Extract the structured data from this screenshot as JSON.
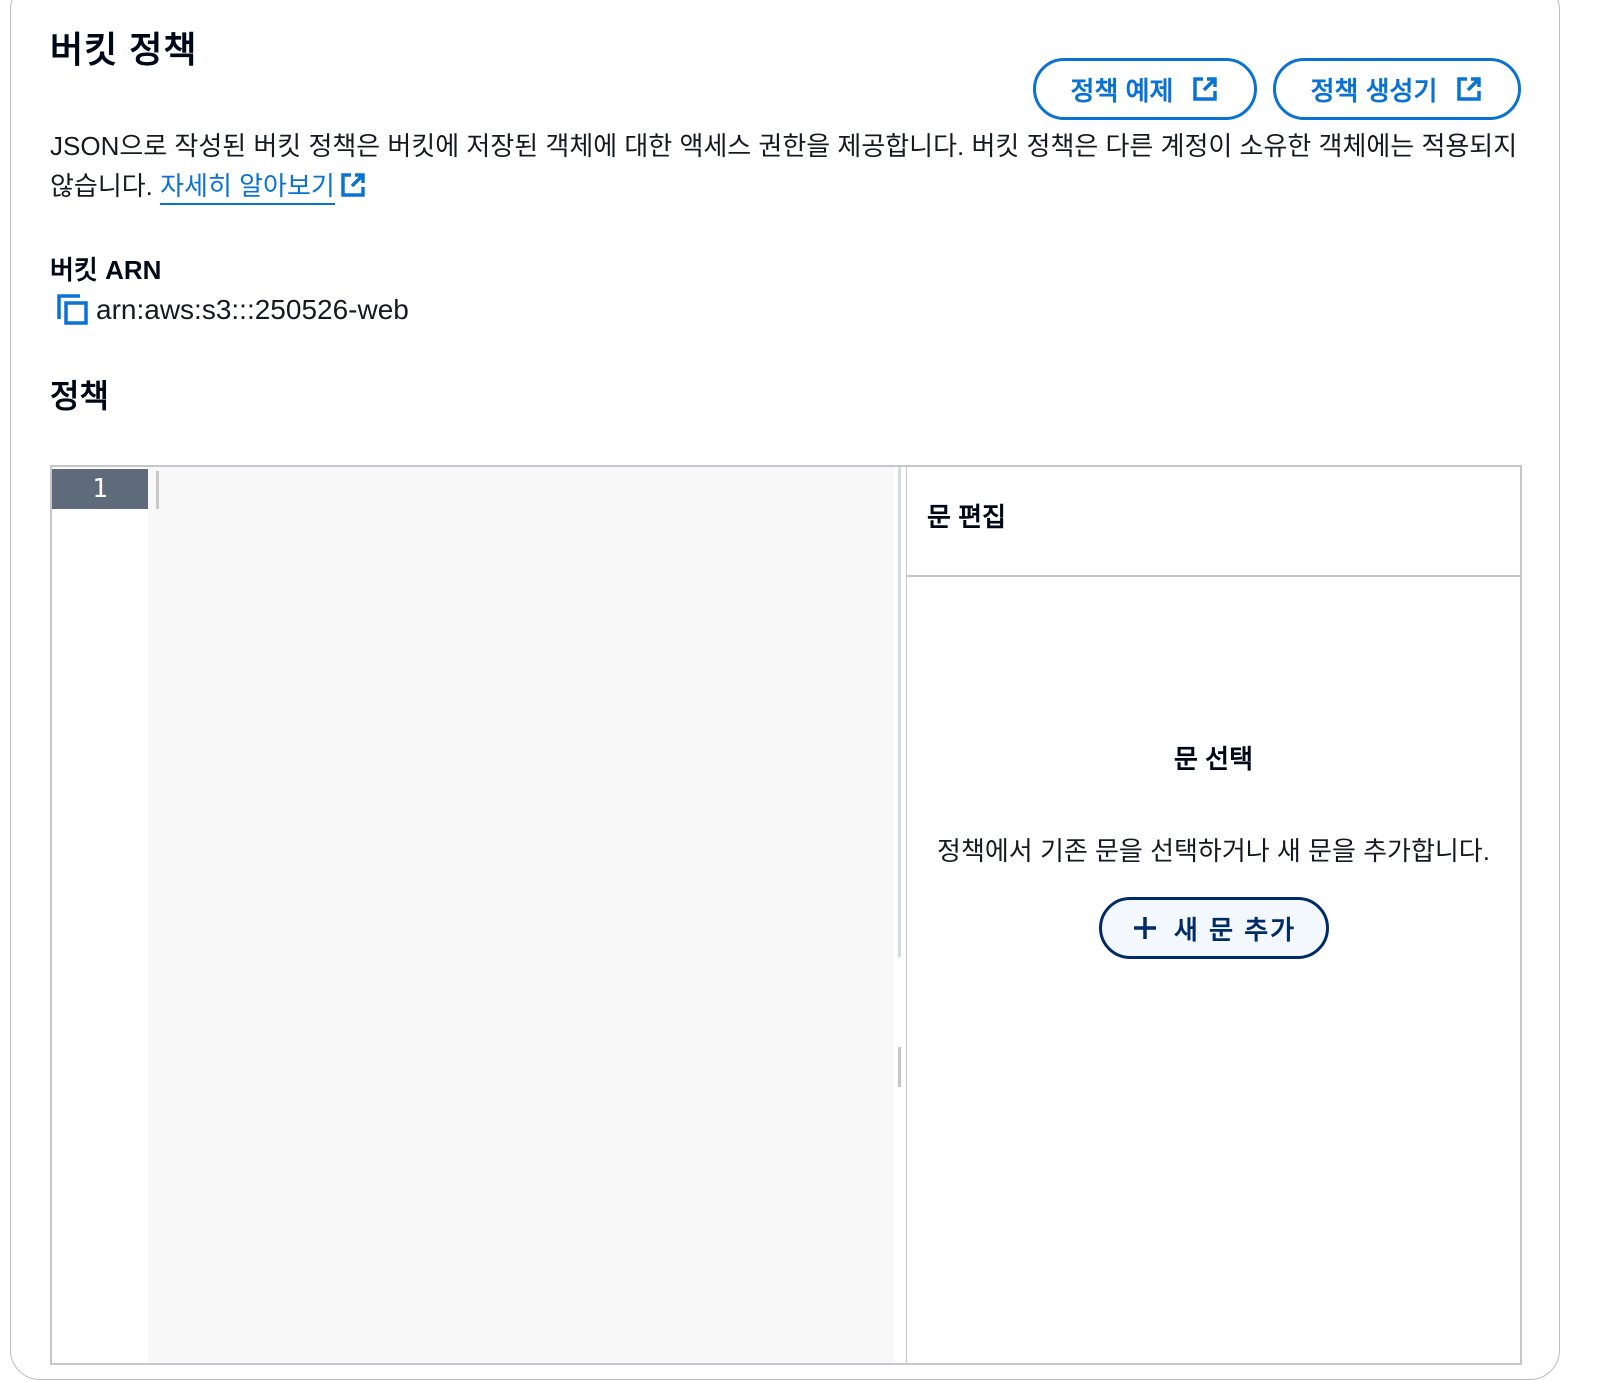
{
  "header": {
    "title": "버킷 정책",
    "buttons": {
      "policy_examples": "정책 예제",
      "policy_generator": "정책 생성기"
    }
  },
  "description": {
    "text": "JSON으로 작성된 버킷 정책은 버킷에 저장된 객체에 대한 액세스 권한을 제공합니다. 버킷 정책은 다른 계정이 소유한 객체에는 적용되지 않습니다.",
    "learn_more": "자세히 알아보기"
  },
  "bucket_arn": {
    "label": "버킷 ARN",
    "value": "arn:aws:s3:::250526-web"
  },
  "policy": {
    "section_title": "정책",
    "editor": {
      "line_numbers": [
        "1"
      ]
    },
    "statement_panel": {
      "title": "문 편집",
      "empty_title": "문 선택",
      "empty_description": "정책에서 기존 문을 선택하거나 새 문을 추가합니다.",
      "add_button": "새 문 추가"
    }
  },
  "icons": {
    "external": "external-link-icon",
    "copy": "copy-icon",
    "add": "plus-icon"
  },
  "colors": {
    "link": "#0972d3",
    "primary_dark": "#002b66",
    "gutter_active": "#5f6b7a",
    "editor_bg": "#f8f8f8"
  }
}
